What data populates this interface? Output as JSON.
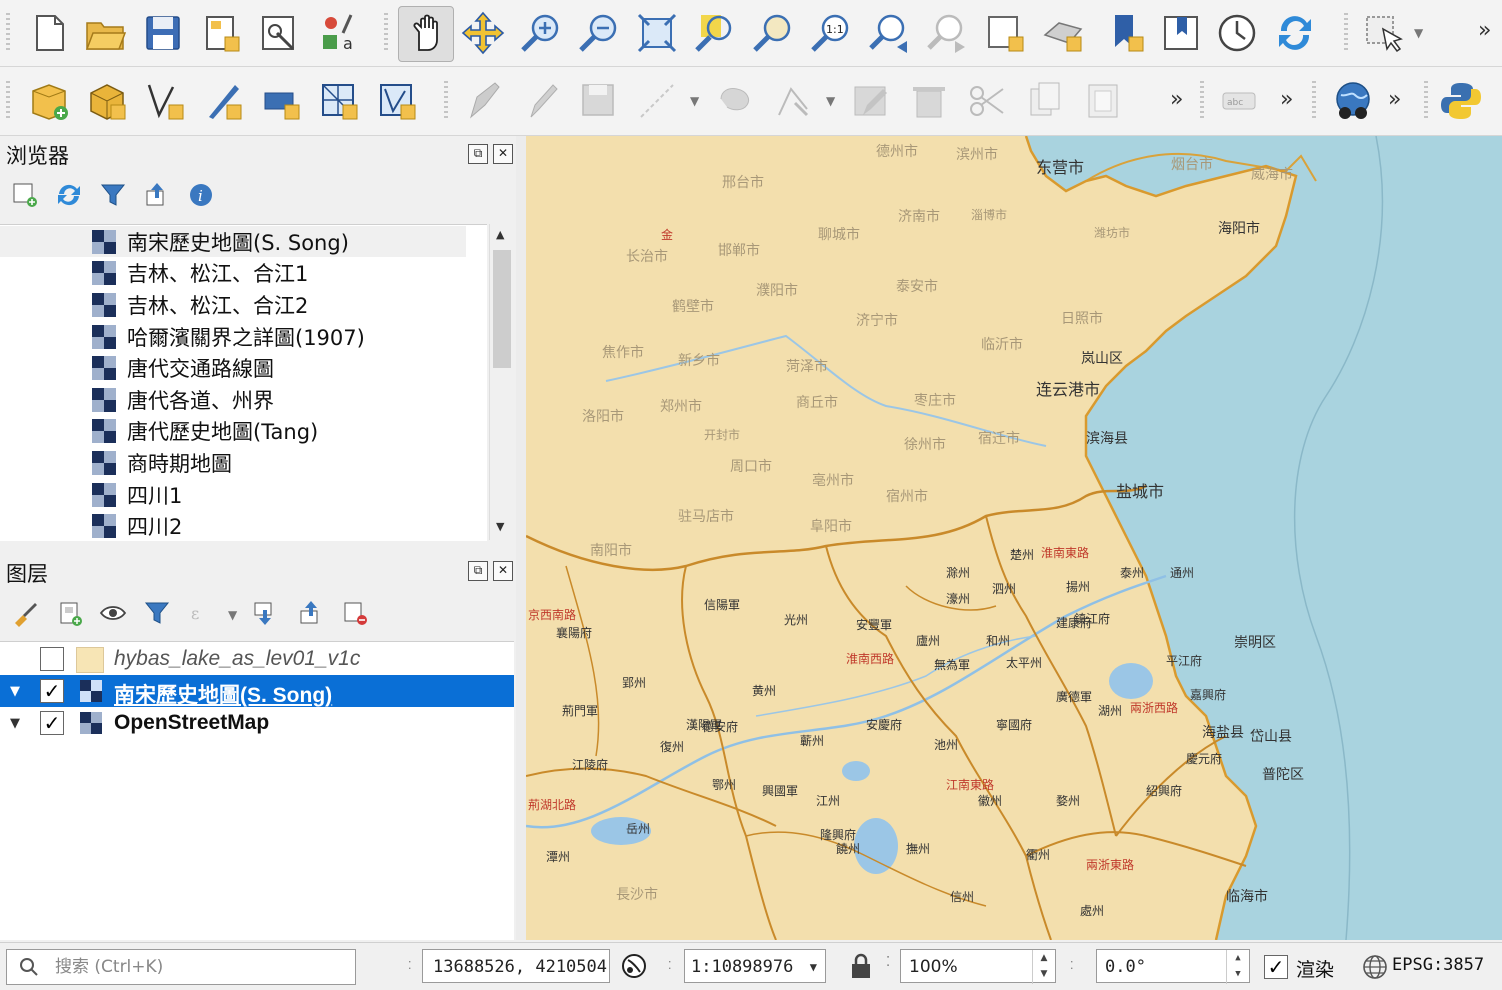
{
  "toolbar_row1": {
    "icons": [
      "new-project-icon",
      "open-project-icon",
      "save-project-icon",
      "new-print-layout-icon",
      "layout-manager-icon",
      "style-manager-icon",
      "pan-map-icon",
      "pan-to-selection-icon",
      "zoom-in-icon",
      "zoom-out-icon",
      "zoom-full-icon",
      "zoom-to-selection-icon",
      "zoom-to-layer-icon",
      "zoom-native-resolution-icon",
      "zoom-last-icon",
      "zoom-next-icon",
      "new-map-view-icon",
      "new-3d-map-view-icon",
      "new-spatial-bookmark-icon",
      "show-bookmarks-icon",
      "temporal-controller-icon",
      "refresh-icon",
      "select-features-icon"
    ],
    "more_label": "»"
  },
  "toolbar_row2": {
    "more_label": "»"
  },
  "browser_panel": {
    "title": "浏览器",
    "items": [
      {
        "label": "南宋歷史地圖(S. Song)",
        "selected": true
      },
      {
        "label": "吉林、松江、合江1"
      },
      {
        "label": "吉林、松江、合江2"
      },
      {
        "label": "哈爾濱關界之詳圖(1907)"
      },
      {
        "label": "唐代交通路線圖"
      },
      {
        "label": "唐代各道、州界"
      },
      {
        "label": "唐代歷史地圖(Tang)"
      },
      {
        "label": "商時期地圖"
      },
      {
        "label": "四川1"
      },
      {
        "label": "四川2"
      }
    ]
  },
  "layers_panel": {
    "title": "图层",
    "layers": [
      {
        "label": "hybas_lake_as_lev01_v1c",
        "checked": false,
        "check_mark": ""
      },
      {
        "label": "南宋歷史地圖(S. Song)",
        "checked": true,
        "check_mark": "✓"
      },
      {
        "label": "OpenStreetMap",
        "checked": true,
        "check_mark": "✓"
      }
    ]
  },
  "map": {
    "labels": {
      "dongying": "东营市",
      "binzhou": "滨州市",
      "dezhou": "德州市",
      "yantai": "烟台市",
      "weihai": "威海市",
      "liaocheng": "聊城市",
      "jinan": "济南市",
      "zibo": "淄博市",
      "weifang": "潍坊市",
      "qingdao": "海阳市",
      "handan": "邯郸市",
      "xingtai": "邢台市",
      "changzhi": "长治市",
      "taian": "泰安市",
      "linyi": "临沂市",
      "rizhao": "日照市",
      "puyang": "濮阳市",
      "hebi": "鹤壁市",
      "xinxiang": "新乡市",
      "jiaozuo": "焦作市",
      "heze": "菏泽市",
      "jining": "济宁市",
      "zaozhuang": "枣庄市",
      "lianyungang": "连云港市",
      "lanshan": "岚山区",
      "luoyang": "洛阳市",
      "zhengzhou": "郑州市",
      "kaifeng": "开封市",
      "shangqiu": "商丘市",
      "xuzhou": "徐州市",
      "suqian": "宿迁市",
      "binhai": "滨海县",
      "zhoukou": "周口市",
      "bozhou": "亳州市",
      "suzhou": "宿州市",
      "yancheng": "盐城市",
      "zhumadian": "驻马店市",
      "fuyang": "阜阳市",
      "nanyang": "南阳市",
      "huaian": "淮南東路",
      "huainanxi": "淮南西路",
      "jingxi": "京西南路",
      "jinghu": "荊湖北路",
      "jiangnandong": "江南東路",
      "liangzhe": "兩浙西路",
      "liangzhedong": "兩浙東路",
      "zhenjiang": "鎮江府",
      "pingjiang": "平江府",
      "jiaxing": "嘉興府",
      "huzhou": "湖州",
      "putuo": "普陀区",
      "daishan": "岱山县",
      "haiyan": "海盐县",
      "chongming": "崇明区",
      "lingshui": "临海市",
      "jin": "金",
      "yangzhou": "揚州",
      "chuzhou": "滁州",
      "luzhou": "廬州",
      "hezhou": "和州",
      "wuwei": "無為軍",
      "taiping": "太平州",
      "anqing": "安慶府",
      "chizhou": "池州",
      "huizhou": "徽州",
      "jiangzhou": "江州",
      "ezhou": "鄂州",
      "yuezhou": "岳州",
      "qizhou": "蘄州",
      "huangzhou": "黄州",
      "xiangyang": "襄陽府",
      "yingzhou": "郢州",
      "xinyang": "信陽軍",
      "guangzhou": "光州",
      "shouchun": "安豐軍",
      "haozhou": "濠州",
      "sizhou": "泗州",
      "chuzhou2": "楚州",
      "taizhou": "泰州",
      "tongzhou": "通州",
      "raozhou": "饒州",
      "xinzhou": "信州",
      "quzhou": "衢州",
      "wuzhou": "婺州",
      "yuzhou": "處州",
      "shaoxing": "紹興府",
      "mingzhou": "慶元府",
      "guangde": "廣德軍",
      "ningguo": "寧國府",
      "jiankang": "建康府",
      "fuzhou": "撫州",
      "hongzhou": "隆興府",
      "xingguo": "興國軍",
      "dean": "德安府",
      "jingmen": "荊門軍",
      "fuzhou2": "復州",
      "hanyang": "漢陽軍",
      "jiangling": "江陵府",
      "tanzhou": "潭州",
      "yueyang": "長沙市"
    }
  },
  "statusbar": {
    "search_placeholder": "搜索 (Ctrl+K)",
    "coordinate": "13688526, 4210504",
    "scale": "1:10898976",
    "magnifier": "100%",
    "rotation": "0.0°",
    "render_label": "渲染",
    "render_checked": "✓",
    "crs": "EPSG:3857"
  }
}
